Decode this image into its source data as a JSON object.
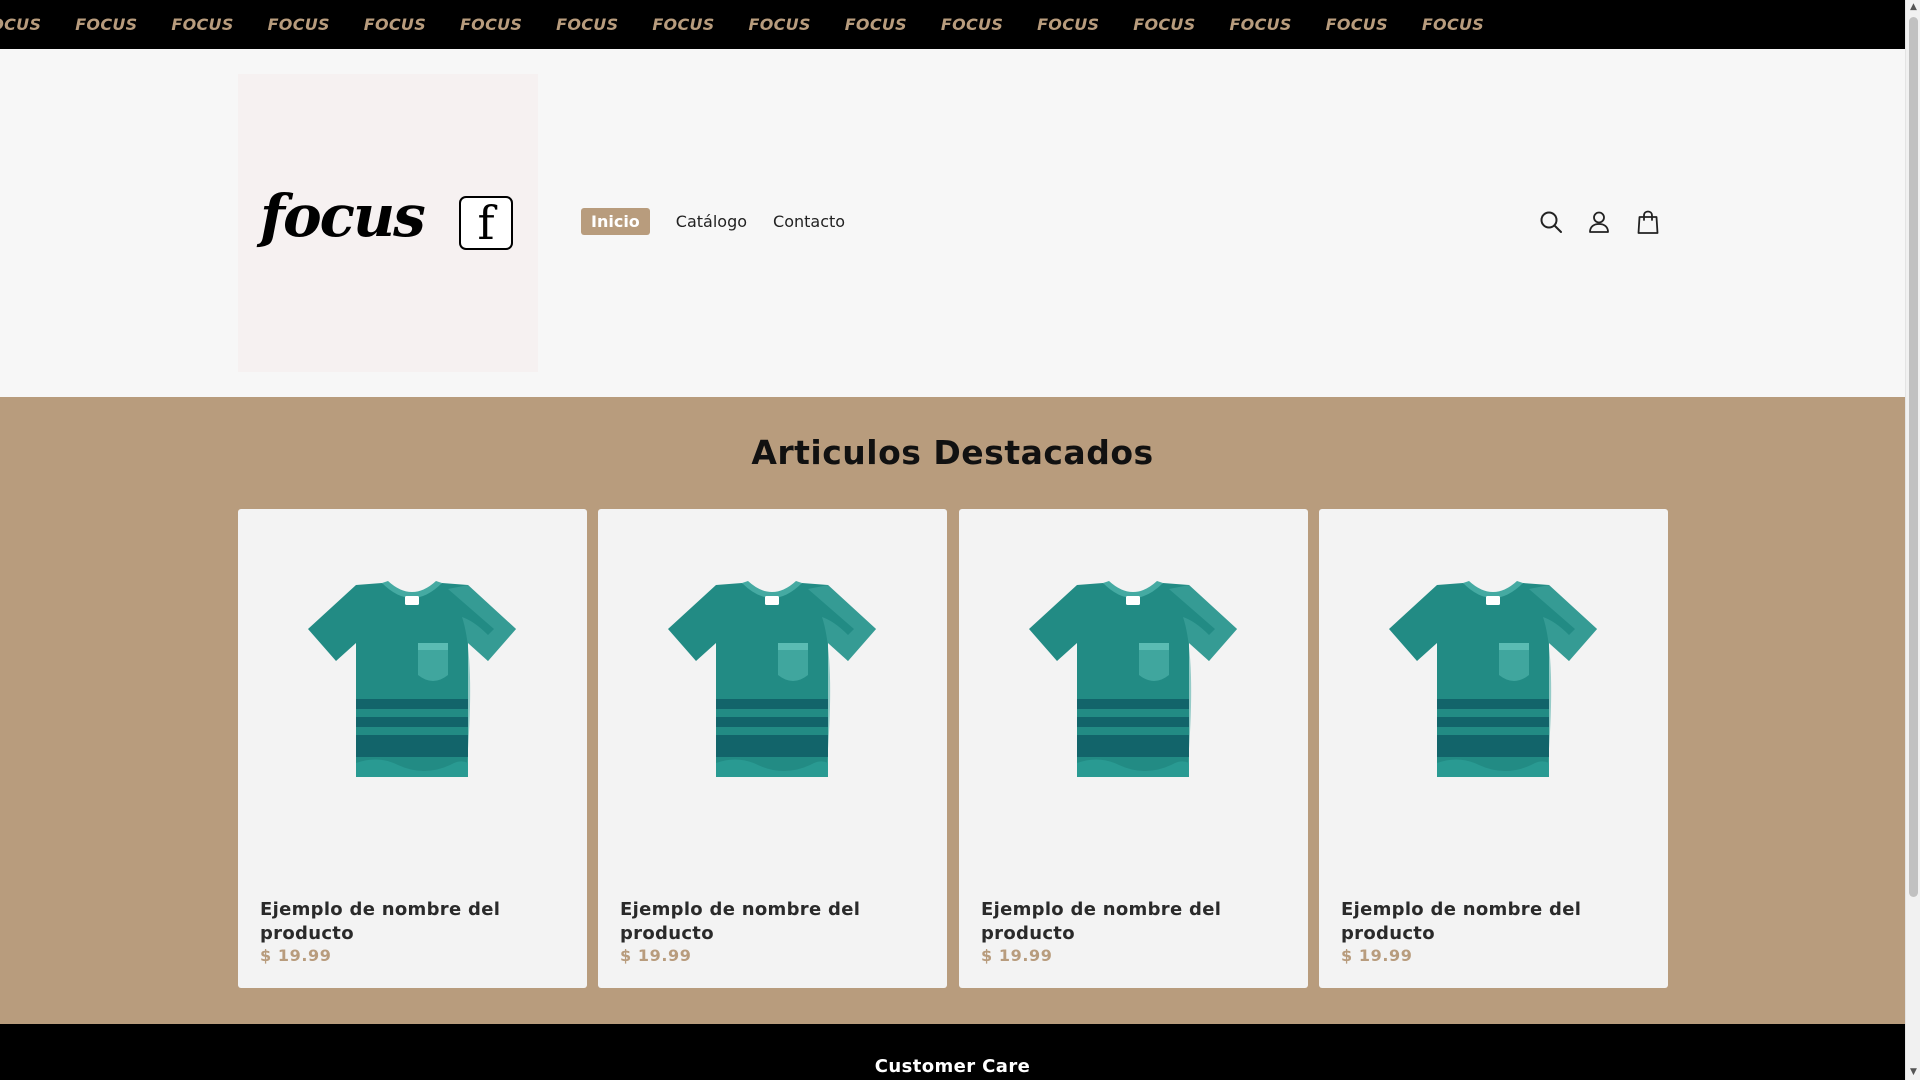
{
  "announcement": {
    "items": [
      "FOCUS",
      "FOCUS",
      "FOCUS",
      "FOCUS",
      "FOCUS",
      "FOCUS",
      "FOCUS",
      "FOCUS",
      "FOCUS",
      "FOCUS",
      "FOCUS",
      "FOCUS",
      "FOCUS",
      "FOCUS",
      "FOCUS",
      "FOCUS"
    ]
  },
  "header": {
    "logo": {
      "wordmark": "focus",
      "mark": "f"
    },
    "nav": [
      {
        "label": "Inicio",
        "active": true
      },
      {
        "label": "Catálogo",
        "active": false
      },
      {
        "label": "Contacto",
        "active": false
      }
    ],
    "icons": [
      "search-icon",
      "account-icon",
      "cart-icon"
    ]
  },
  "featured": {
    "title": "Articulos Destacados",
    "products": [
      {
        "name": "Ejemplo de nombre del producto",
        "price": "$ 19.99"
      },
      {
        "name": "Ejemplo de nombre del producto",
        "price": "$ 19.99"
      },
      {
        "name": "Ejemplo de nombre del producto",
        "price": "$ 19.99"
      },
      {
        "name": "Ejemplo de nombre del producto",
        "price": "$ 19.99"
      }
    ]
  },
  "footer": {
    "title": "Customer Care"
  },
  "colors": {
    "accent": "#b89c7d",
    "product": "#228b84",
    "product_dark": "#12646a",
    "product_light": "#45aaa2"
  }
}
